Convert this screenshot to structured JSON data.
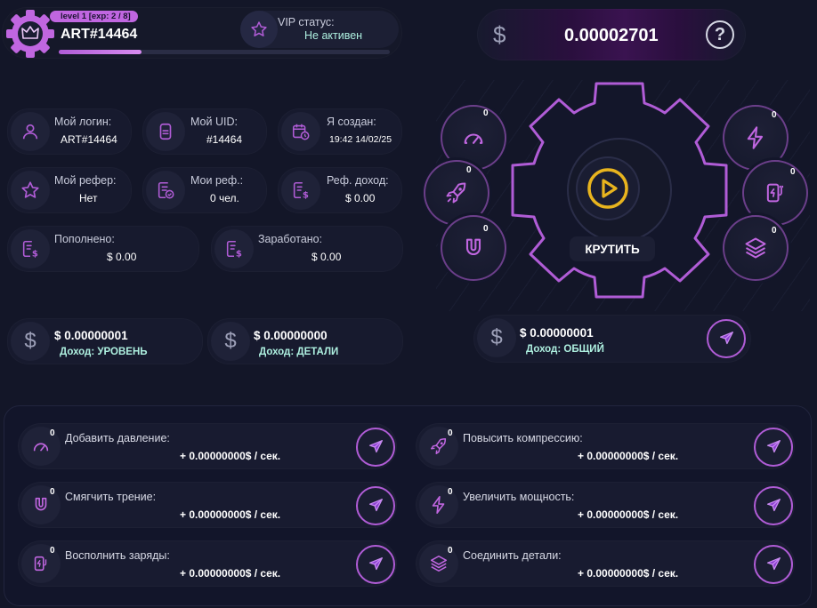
{
  "header": {
    "level_badge": "level 1 [exp: 2 / 8]",
    "user": "ART#14464",
    "exp_fraction": 0.25,
    "vip_label": "VIP статус:",
    "vip_value": "Не активен",
    "balance": "0.00002701",
    "currency_icon": "dollar-icon",
    "help_icon": "question-icon"
  },
  "stats": {
    "login_label": "Мой логин:",
    "login_value": "ART#14464",
    "uid_label": "Мой UID:",
    "uid_value": "#14464",
    "created_label": "Я создан:",
    "created_value": "19:42 14/02/25",
    "referrer_label": "Мой рефер:",
    "referrer_value": "Нет",
    "refs_label": "Мои реф.:",
    "refs_value": "0 чел.",
    "ref_income_label": "Реф. доход:",
    "ref_income_value": "$ 0.00",
    "deposited_label": "Пополнено:",
    "deposited_value": "$ 0.00",
    "earned_label": "Заработано:",
    "earned_value": "$ 0.00"
  },
  "income": {
    "level_amount": "$ 0.00000001",
    "level_label": "Доход: УРОВЕНЬ",
    "parts_amount": "$ 0.00000000",
    "parts_label": "Доход: ДЕТАЛИ",
    "total_amount": "$ 0.00000001",
    "total_label": "Доход: ОБЩИЙ"
  },
  "gear": {
    "spin_label": "КРУТИТЬ",
    "orbs": [
      {
        "icon": "speedometer-icon",
        "count": "0"
      },
      {
        "icon": "rocket-icon",
        "count": "0"
      },
      {
        "icon": "magnet-icon",
        "count": "0"
      },
      {
        "icon": "lightning-icon",
        "count": "0"
      },
      {
        "icon": "battery-charge-icon",
        "count": "0"
      },
      {
        "icon": "layers-icon",
        "count": "0"
      }
    ]
  },
  "upgrades": [
    {
      "icon": "speedometer-icon",
      "count": "0",
      "label": "Добавить давление:",
      "rate": "+ 0.00000000$ / сек."
    },
    {
      "icon": "rocket-icon",
      "count": "0",
      "label": "Повысить компрессию:",
      "rate": "+ 0.00000000$ / сек."
    },
    {
      "icon": "magnet-icon",
      "count": "0",
      "label": "Смягчить трение:",
      "rate": "+ 0.00000000$ / сек."
    },
    {
      "icon": "lightning-icon",
      "count": "0",
      "label": "Увеличить мощность:",
      "rate": "+ 0.00000000$ / сек."
    },
    {
      "icon": "battery-charge-icon",
      "count": "0",
      "label": "Восполнить заряды:",
      "rate": "+ 0.00000000$ / сек."
    },
    {
      "icon": "layers-icon",
      "count": "0",
      "label": "Соединить детали:",
      "rate": "+ 0.00000000$ / сек."
    }
  ],
  "colors": {
    "background": "#131628",
    "card": "#171a2e",
    "accent_purple": "#b05cd6",
    "gold": "#e8b41e",
    "value_teal": "#aef0e0"
  }
}
